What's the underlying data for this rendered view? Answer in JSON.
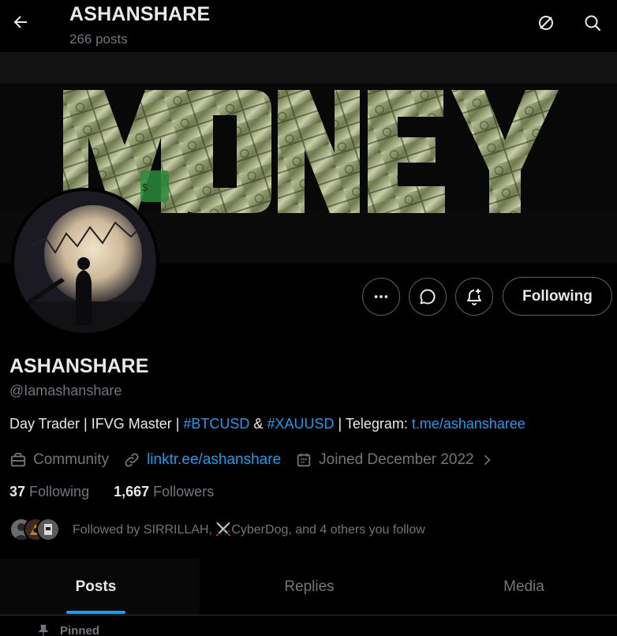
{
  "header": {
    "title": "ASHANSHARE",
    "posts_count": "266 posts"
  },
  "banner": {
    "text": "MONEY"
  },
  "actions": {
    "following_label": "Following"
  },
  "profile": {
    "display_name": "ASHANSHARE",
    "handle": "@Iamashanshare",
    "bio": {
      "part1": "Day Trader | IFVG Master | ",
      "tag1": "#BTCUSD",
      "part2": " & ",
      "tag2": "#XAUUSD",
      "part3": " | Telegram: ",
      "telegram_link": "t.me/ashansharee"
    },
    "category": "Community",
    "website": "linktr.ee/ashanshare",
    "joined": "Joined December 2022",
    "following_count": "37",
    "following_label": "Following",
    "followers_count": "1,667",
    "followers_label": "Followers",
    "followed_by": "Followed by SIRRILLAH, ⚔️CyberDog, and 4 others you follow"
  },
  "tabs": [
    {
      "label": "Posts",
      "active": true
    },
    {
      "label": "Replies",
      "active": false
    },
    {
      "label": "Media",
      "active": false
    }
  ],
  "pinned_label": "Pinned",
  "icons": [
    "back-arrow-icon",
    "grok-icon",
    "search-icon",
    "more-icon",
    "message-icon",
    "notification-add-icon",
    "briefcase-icon",
    "link-icon",
    "calendar-icon",
    "chevron-right-icon",
    "pin-icon"
  ],
  "colors": {
    "background": "#000000",
    "text_primary": "#e7e9ea",
    "text_secondary": "#71767b",
    "accent": "#1d9bf0",
    "border": "#536471"
  }
}
